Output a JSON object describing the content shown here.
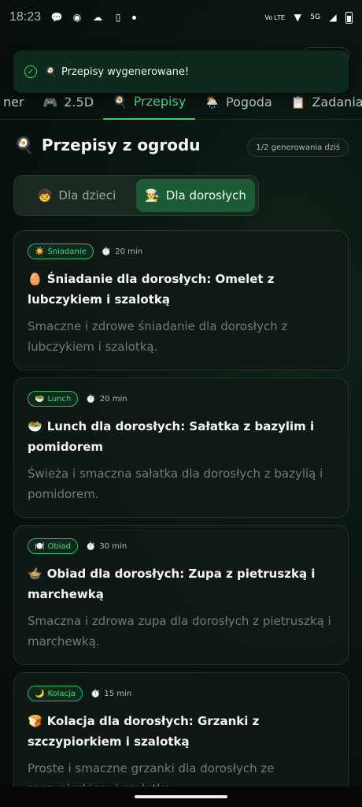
{
  "status_bar": {
    "time": "18:23",
    "network_label": "Vo LTE",
    "signal_label": "5G"
  },
  "toast": {
    "emoji": "🍳",
    "message": "Przepisy wygenerowane!"
  },
  "tabs": [
    {
      "icon": "",
      "label": "ner"
    },
    {
      "icon": "🎮",
      "label": "2.5D"
    },
    {
      "icon": "🍳",
      "label": "Przepisy"
    },
    {
      "icon": "🌦️",
      "label": "Pogoda"
    },
    {
      "icon": "📋",
      "label": "Zadania (:"
    }
  ],
  "active_tab": "Przepisy",
  "section": {
    "icon": "🍳",
    "title": "Przepisy z ogrodu",
    "generation_count": "1/2 generowania dziś"
  },
  "audience_toggle": {
    "options": [
      {
        "icon": "🧒",
        "label": "Dla dzieci"
      },
      {
        "icon": "👨‍🍳",
        "label": "Dla dorosłych"
      }
    ],
    "selected": "Dla dorosłych"
  },
  "recipes": [
    {
      "badge_icon": "☀️",
      "badge": "Śniadanie",
      "time": "20 min",
      "title_icon": "🥚",
      "title": "Śniadanie dla dorosłych: Omelet z lubczykiem i szalotką",
      "description": "Smaczne i zdrowe śniadanie dla dorosłych z lubczykiem i szalotką."
    },
    {
      "badge_icon": "🥗",
      "badge": "Lunch",
      "time": "20 min",
      "title_icon": "🥗",
      "title": "Lunch dla dorosłych: Sałatka z bazylim i pomidorem",
      "description": "Świeża i smaczna sałatka dla dorosłych z bazylią i pomidorem."
    },
    {
      "badge_icon": "🍽️",
      "badge": "Obiad",
      "time": "30 min",
      "title_icon": "🍲",
      "title": "Obiad dla dorosłych: Zupa z pietruszką i marchewką",
      "description": "Smaczna i zdrowa zupa dla dorosłych z pietruszką i marchewką."
    },
    {
      "badge_icon": "🌙",
      "badge": "Kolacja",
      "time": "15 min",
      "title_icon": "🍞",
      "title": "Kolacja dla dorosłych: Grzanki z szczypiorkiem i szalotką",
      "description": "Proste i smaczne grzanki dla dorosłych ze szczypiorkiem i szalotką."
    }
  ],
  "colors": {
    "accent": "#3ee089",
    "background": "#0a1410",
    "card": "#121a15",
    "toast": "#0e2a1c"
  }
}
